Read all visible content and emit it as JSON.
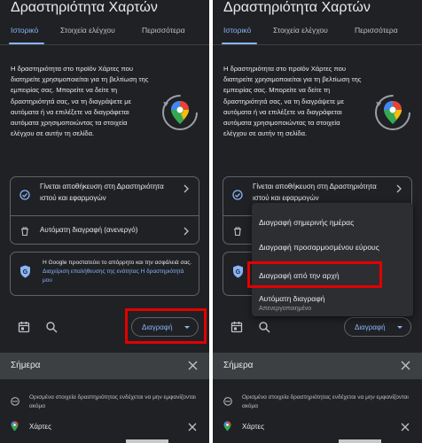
{
  "page": {
    "title": "Δραστηριότητα Χαρτών",
    "tabs": [
      "Ιστορικό",
      "Στοιχεία ελέγχου",
      "Περισσότερα"
    ],
    "active_tab": "Ιστορικό"
  },
  "description": "Η δραστηριότητα στο προϊόν Χάρτες που διατηρείτε χρησιμοποιείται για τη βελτίωση της εμπειρίας σας. Μπορείτε να δείτε τη δραστηριότητά σας, να τη διαγράψετε με αυτόματα ή να επιλέξετε να διαγράφεται αυτόματα χρησιμοποιώντας τα στοιχεία ελέγχου σε αυτήν τη σελίδα.",
  "settings_card": {
    "saving_label": "Γίνεται αποθήκευση στη Δραστηριότητα ιστού και εφαρμογών",
    "autodelete_label": "Αυτόματη διαγραφή (ανενεργό)"
  },
  "protect_card": {
    "text": "Η Google προστατεύει το απόρρητο και την ασφάλειά σας.",
    "link": "Διαχείριση επαλήθευσης της ενότητας Η δραστηριότητά μου"
  },
  "toolbar": {
    "delete_label": "Διαγραφή"
  },
  "delete_menu": {
    "items": [
      "Διαγραφή σημερινής ημέρας",
      "Διαγραφή προσαρμοσμένου εύρους",
      "Διαγραφή από την αρχή",
      "Αυτόματη διαγραφή"
    ],
    "autodelete_status": "Απενεργοποιημένο"
  },
  "today_section": {
    "title": "Σήμερα",
    "info": "Ορισμένα στοιχεία δραστηριότητας ενδέχεται να μην εμφανίζονται ακόμα",
    "item_label": "Χάρτες"
  },
  "colors": {
    "background": "#202124",
    "accent": "#8ab4f8",
    "highlight": "#e30000"
  }
}
